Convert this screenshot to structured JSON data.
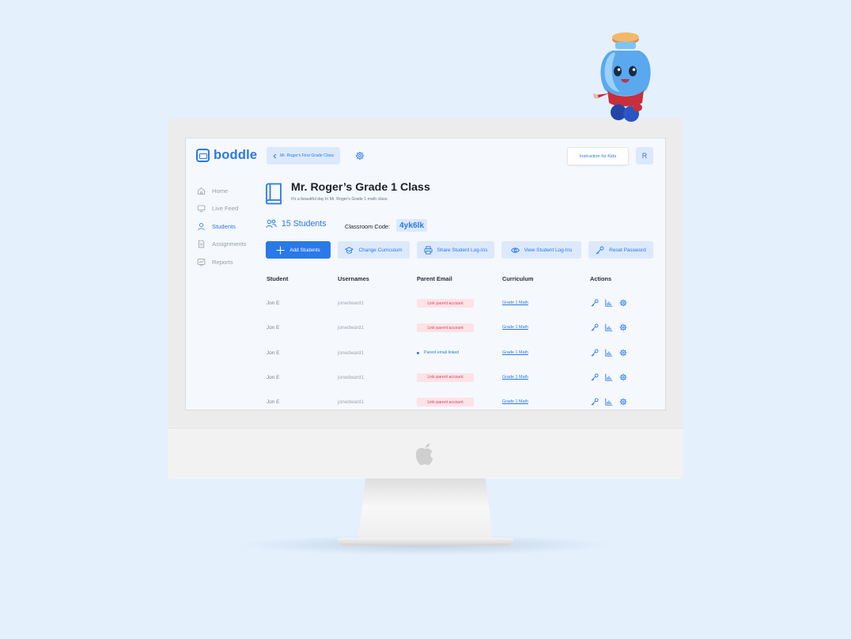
{
  "app": {
    "logo": "boddle",
    "breadcrumb": "Mr. Roger's First Grade Class",
    "instruction_button": "Instruction for Kids",
    "avatar_initial": "R"
  },
  "sidebar": {
    "items": [
      {
        "label": "Home",
        "icon": "home-icon",
        "active": false
      },
      {
        "label": "Live Feed",
        "icon": "monitor-icon",
        "active": false
      },
      {
        "label": "Students",
        "icon": "user-icon",
        "active": true
      },
      {
        "label": "Assignments",
        "icon": "document-icon",
        "active": false
      },
      {
        "label": "Reports",
        "icon": "chart-screen-icon",
        "active": false
      }
    ]
  },
  "class": {
    "title": "Mr. Roger’s Grade 1 Class",
    "subtitle": "It's a beautiful day in Mr. Roger's Grade 1 math class.",
    "students_count": "15 Students",
    "code_label": "Classroom Code:",
    "code_value": "4yk6lk"
  },
  "actions": {
    "add_students": "Add Students",
    "change_curriculum": "Change Curriculum",
    "share_logins": "Share Student Log-Ins",
    "view_logins": "View Student Log-Ins",
    "reset_password": "Reset Password"
  },
  "table": {
    "headers": [
      "Student",
      "Usernames",
      "Parent Email",
      "Curriculum",
      "Actions"
    ],
    "rows": [
      {
        "student": "Jon E",
        "username": "jonedward1",
        "parent_email": "Link parent account",
        "linked": false,
        "curriculum": "Grade 1 Math"
      },
      {
        "student": "Jon E",
        "username": "jonedward1",
        "parent_email": "Link parent account",
        "linked": false,
        "curriculum": "Grade 1 Math"
      },
      {
        "student": "Jon E",
        "username": "jonedward1",
        "parent_email": "Parent email linked",
        "linked": true,
        "curriculum": "Grade 1 Math"
      },
      {
        "student": "Jon E",
        "username": "jonedward1",
        "parent_email": "Link parent account",
        "linked": false,
        "curriculum": "Grade 1 Math"
      },
      {
        "student": "Jon E",
        "username": "jonedward1",
        "parent_email": "Link parent account",
        "linked": false,
        "curriculum": "Grade 1 Math"
      }
    ]
  },
  "colors": {
    "accent": "#2a79e8",
    "accent_light": "#dce9fb",
    "warning_bg": "#fde2e6",
    "warning_text": "#e0445a",
    "background": "#e4f0fc"
  }
}
